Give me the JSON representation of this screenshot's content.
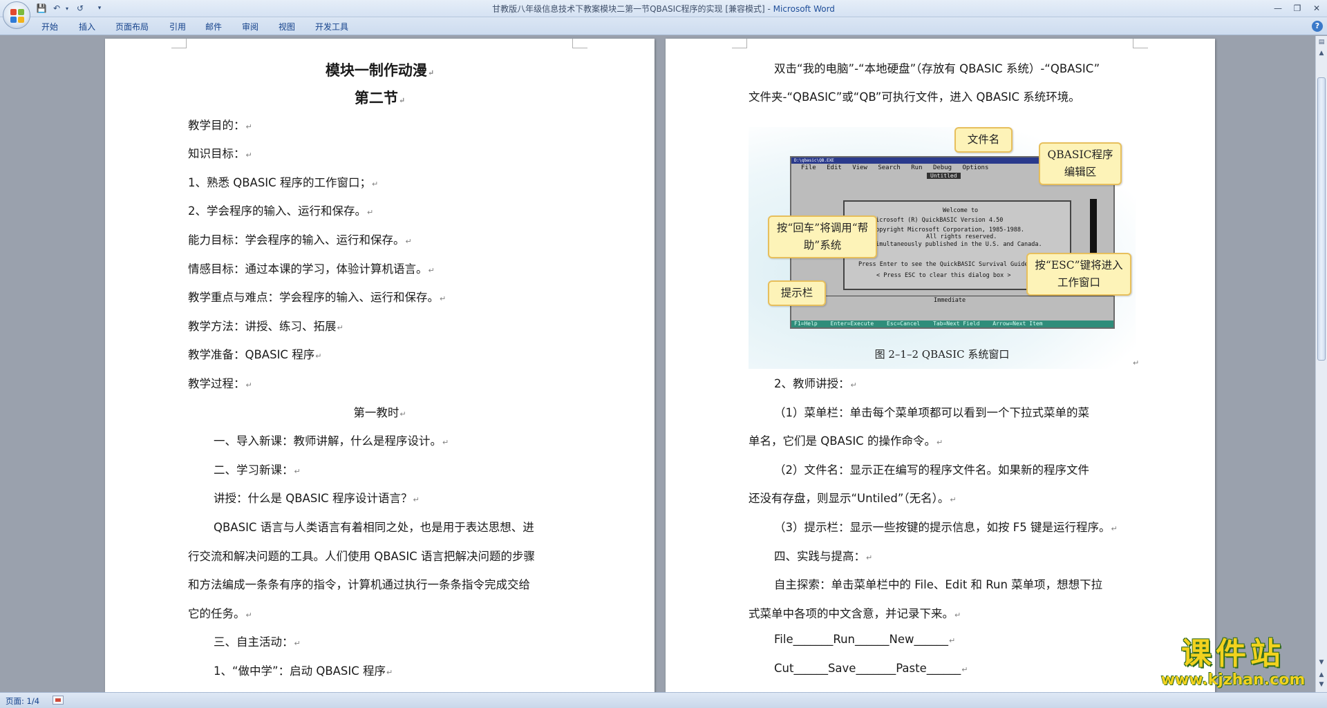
{
  "window": {
    "title": "甘教版八年级信息技术下教案模块二第一节QBASIC程序的实现 [兼容模式] - ",
    "app_name": "Microsoft Word",
    "quick_access": {
      "customize": "▾"
    }
  },
  "ribbon": {
    "tabs": [
      "开始",
      "插入",
      "页面布局",
      "引用",
      "邮件",
      "审阅",
      "视图",
      "开发工具"
    ]
  },
  "page1": {
    "title": "模块一制作动漫",
    "subtitle": "第二节",
    "lines": [
      "教学目的：",
      "知识目标：",
      "1、熟悉 QBASIC 程序的工作窗口；",
      "2、学会程序的输入、运行和保存。",
      "能力目标：学会程序的输入、运行和保存。",
      "情感目标：通过本课的学习，体验计算机语言。",
      "教学重点与难点：学会程序的输入、运行和保存。",
      "教学方法：讲授、练习、拓展",
      "教学准备：QBASIC 程序",
      "教学过程："
    ],
    "session": "第一教时",
    "body": [
      "一、导入新课：教师讲解，什么是程序设计。",
      "二、学习新课：",
      "讲授：什么是 QBASIC  程序设计语言？",
      "QBASIC  语言与人类语言有着相同之处，也是用于表达思想、进",
      "行交流和解决问题的工具。人们使用 QBASIC 语言把解决问题的步骤",
      "和方法编成一条条有序的指令，计算机通过执行一条条指令完成交给",
      "它的任务。",
      "三、自主活动：",
      "1、“做中学”：启动 QBASIC 程序"
    ]
  },
  "page2": {
    "intro": [
      "双击“我的电脑”-“本地硬盘”（存放有 QBASIC 系统）-“QBASIC”",
      "文件夹-“QBASIC”或“QB”可执行文件，进入  QBASIC  系统环境。"
    ],
    "figure": {
      "caption": "图 2–1–2    QBASIC 系统窗口",
      "window_title": "D:\\qbasic\\QB.EXE",
      "menu": [
        "File",
        "Edit",
        "View",
        "Search",
        "Run",
        "Debug",
        "Options"
      ],
      "untitled": "Untitled",
      "dialog": [
        "Welcome to",
        "Microsoft (R) QuickBASIC Version 4.50",
        "Copyright Microsoft Corporation, 1985-1988.",
        "All rights reserved.",
        "Simultaneously published in the U.S. and Canada.",
        "Press Enter to see the QuickBASIC Survival Guide",
        "< Press ESC to clear this dialog box >"
      ],
      "immediate": "Immediate",
      "status": [
        "F1=Help",
        "Enter=Execute",
        "Esc=Cancel",
        "Tab=Next Field",
        "Arrow=Next Item"
      ],
      "callouts": {
        "filename": "文件名",
        "editor": "QBASIC程序编辑区",
        "enter_help": "按“回车”将调用“帮助”系统",
        "esc": "按“ESC”键将进入工作窗口",
        "statusbar": "提示栏"
      }
    },
    "lines": [
      "2、教师讲授：",
      "（1）菜单栏：单击每个菜单项都可以看到一个下拉式菜单的菜",
      "单名，它们是 QBASIC 的操作命令。",
      "（2）文件名：显示正在编写的程序文件名。如果新的程序文件",
      "还没有存盘，则显示“Untiled”（无名）。",
      "（3）提示栏：显示一些按键的提示信息，如按 F5 键是运行程序。",
      "四、实践与提高：",
      "自主探索：单击菜单栏中的 File、Edit 和 Run 菜单项，想想下拉",
      "式菜单中各项的中文含意，并记录下来。",
      "File_______Run______New______",
      "Cut______Save_______Paste______"
    ]
  },
  "statusbar": {
    "page": "页面: 1/4"
  },
  "watermark": {
    "main": "课件站",
    "url": "www.kjzhan.com"
  },
  "paragraph_mark": "↵",
  "colors": {
    "titlebar": "#dbe6f4",
    "app_name": "#1f4e99",
    "watermark": "#f2d21e"
  }
}
